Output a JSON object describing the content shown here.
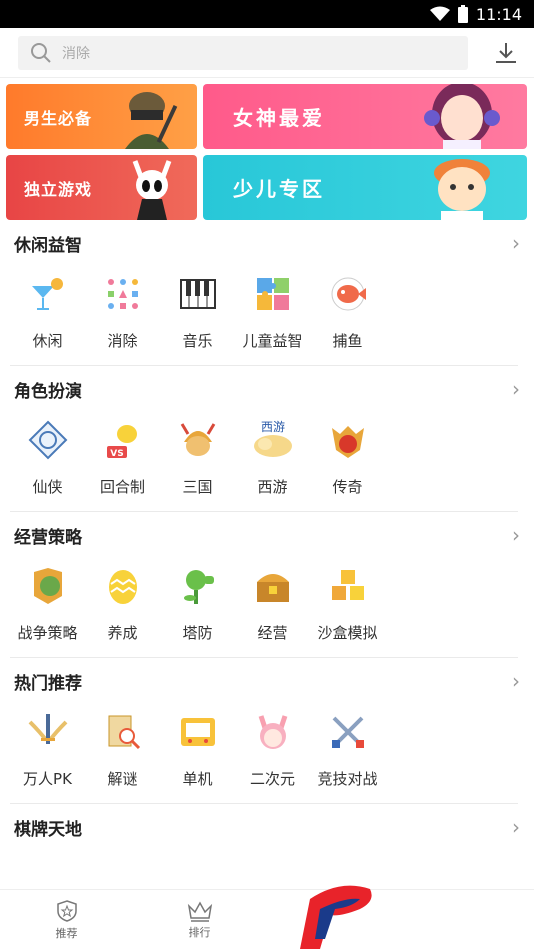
{
  "status": {
    "time": "11:14"
  },
  "search": {
    "placeholder": "消除"
  },
  "banners": [
    {
      "label": "男生必备"
    },
    {
      "label": "女神最爱"
    },
    {
      "label": "独立游戏"
    },
    {
      "label": "少儿专区"
    }
  ],
  "sections": [
    {
      "title": "休闲益智",
      "items": [
        "休闲",
        "消除",
        "音乐",
        "儿童益智",
        "捕鱼"
      ]
    },
    {
      "title": "角色扮演",
      "items": [
        "仙侠",
        "回合制",
        "三国",
        "西游",
        "传奇"
      ]
    },
    {
      "title": "经营策略",
      "items": [
        "战争策略",
        "养成",
        "塔防",
        "经营",
        "沙盒模拟"
      ]
    },
    {
      "title": "热门推荐",
      "items": [
        "万人PK",
        "解谜",
        "单机",
        "二次元",
        "竞技对战"
      ]
    },
    {
      "title": "棋牌天地"
    }
  ],
  "tabs": [
    {
      "label": "推荐"
    },
    {
      "label": "排行"
    }
  ],
  "icons": {
    "xiyou_text": "西游",
    "vs_text": "VS"
  }
}
